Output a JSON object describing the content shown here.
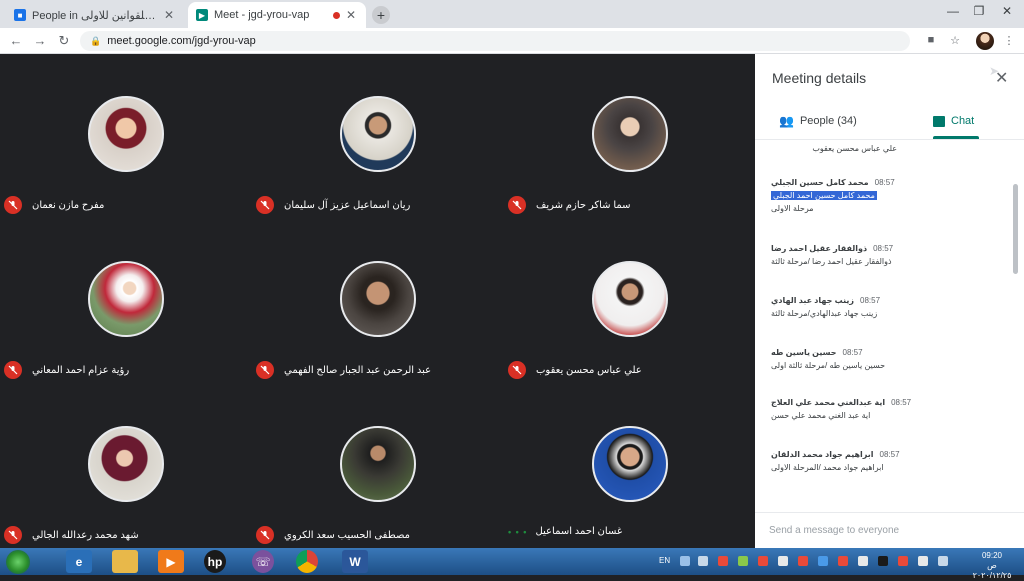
{
  "browser": {
    "tabs": [
      {
        "title": "People in الاصول العامة للقوانين للاولى",
        "icon": "google-classroom-icon",
        "active": false
      },
      {
        "title": "Meet - jgd-yrou-vap",
        "icon": "google-meet-icon",
        "active": true,
        "recording": true
      }
    ],
    "new_tab_label": "+",
    "url": "meet.google.com/jgd-yrou-vap"
  },
  "participants": [
    {
      "name": "مفرح مازن نعمان",
      "muted": true
    },
    {
      "name": "ريان اسماعيل عزيز آل سليمان",
      "muted": true
    },
    {
      "name": "سما شاكر حازم شريف",
      "muted": true
    },
    {
      "name": "رؤية عزام احمد المعاني",
      "muted": true
    },
    {
      "name": "عبد الرحمن عبد الجبار صالح الفهمي",
      "muted": true
    },
    {
      "name": "علي عباس محسن يعقوب",
      "muted": true
    },
    {
      "name": "شهد محمد رعدالله الجالي",
      "muted": true
    },
    {
      "name": "مصطفى الحسيب سعد الكروي",
      "muted": true
    },
    {
      "name": "غسان احمد اسماعيل",
      "muted": false,
      "speaking_indicator": "• • •"
    }
  ],
  "panel": {
    "title": "Meeting details",
    "tab_people": "People (34)",
    "tab_chat": "Chat",
    "top_message": "علي عباس محسن يعقوب",
    "messages": [
      {
        "sender": "محمد كامل حسين الجبلي",
        "time": "08:57",
        "lines": [
          "محمد كامل حسين احمد الجبلي",
          "مرحلة الاولى"
        ],
        "selected_line": 0
      },
      {
        "sender": "ذوالفقار عقيل احمد رضا",
        "time": "08:57",
        "lines": [
          "ذوالفقار عقيل احمد رضا /مرحلة ثالثة"
        ],
        "selected_line": -1
      },
      {
        "sender": "زينب جهاد عبد الهادي",
        "time": "08:57",
        "lines": [
          "زينب جهاد عبدالهادي/مرحلة ثالثة"
        ],
        "selected_line": -1
      },
      {
        "sender": "حسين ياسين طه",
        "time": "08:57",
        "lines": [
          "حسين ياسين طه /مرحلة ثالثة اولى"
        ],
        "selected_line": -1
      },
      {
        "sender": "اية عبدالغني محمد علي العلاج",
        "time": "08:57",
        "lines": [
          "اية عبد الغني محمد علي حسن"
        ],
        "selected_line": -1
      },
      {
        "sender": "ابراهيم جواد محمد الدلقان",
        "time": "08:57",
        "lines": [
          "ابراهيم جواد محمد /المرحلة الاولى"
        ],
        "selected_line": -1
      }
    ],
    "compose_placeholder": "Send a message to everyone"
  },
  "taskbar": {
    "apps": [
      "windows-explorer-icon",
      "ie-icon",
      "folder-icon",
      "media-player-icon",
      "hp-icon",
      "viber-icon",
      "chrome-icon",
      "word-icon"
    ],
    "word_label": "W",
    "hp_label": "hp",
    "language": "EN",
    "time": "09:20",
    "date_line": "ص ٢٠٢٠/١٢/٢٥"
  },
  "colors": {
    "mic_off": "#d93025",
    "chat_accent": "#00796b",
    "meet_bg": "#202124",
    "selection": "#3367d6"
  }
}
